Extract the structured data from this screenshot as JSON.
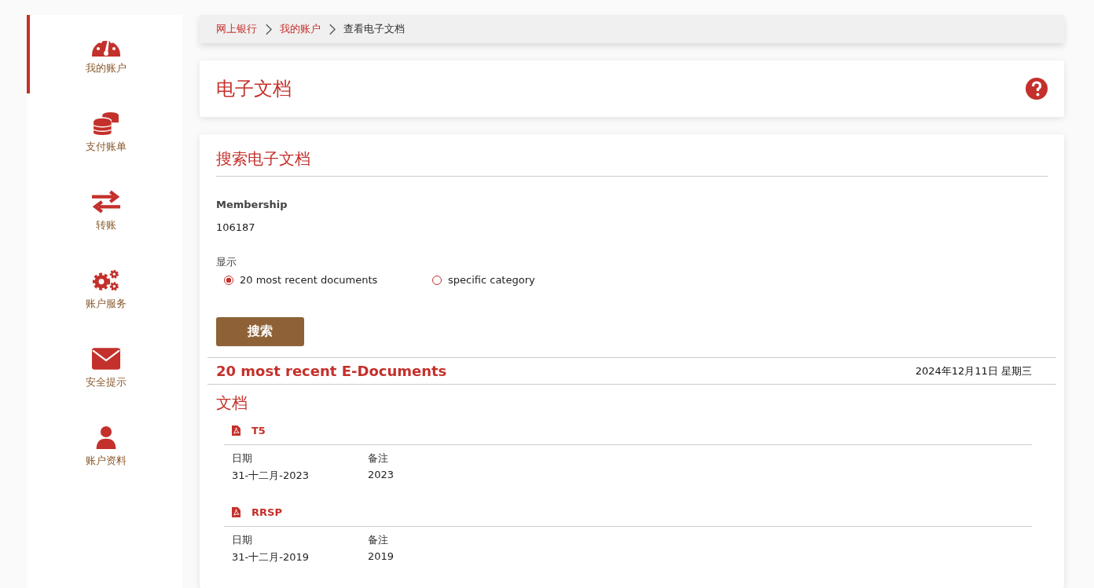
{
  "sidebar": {
    "items": [
      {
        "label": "我的账户",
        "selected": true
      },
      {
        "label": "支付账单",
        "selected": false
      },
      {
        "label": "转账",
        "selected": false
      },
      {
        "label": "账户服务",
        "selected": false
      },
      {
        "label": "安全提示",
        "selected": false
      },
      {
        "label": "账户资料",
        "selected": false
      }
    ]
  },
  "breadcrumb": [
    {
      "label": "网上银行",
      "kind": "link"
    },
    {
      "label": "我的账户",
      "kind": "link"
    },
    {
      "label": "查看电子文档",
      "kind": "current"
    }
  ],
  "page_title": "电子文档",
  "search": {
    "title": "搜索电子文档",
    "membership_label": "Membership",
    "membership_value": "106187",
    "display_label": "显示",
    "options": [
      {
        "label": "20 most recent documents",
        "selected": true
      },
      {
        "label": "specific category",
        "selected": false
      }
    ],
    "button": "搜索"
  },
  "results": {
    "title": "20 most recent E-Documents",
    "date": "2024年12月11日 星期三",
    "section": "文档",
    "documents": [
      {
        "name": "T5",
        "date_label": "日期",
        "date": "31-十二月-2023",
        "note_label": "备注",
        "note": "2023"
      },
      {
        "name": "RRSP",
        "date_label": "日期",
        "date": "31-十二月-2019",
        "note_label": "备注",
        "note": "2019"
      }
    ]
  }
}
